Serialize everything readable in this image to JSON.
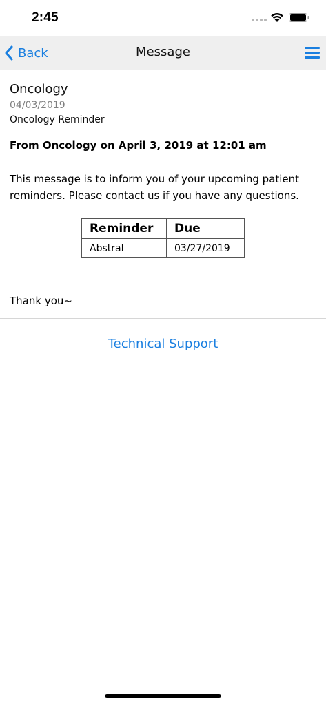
{
  "status_bar": {
    "time": "2:45"
  },
  "nav": {
    "back_label": "Back",
    "title": "Message"
  },
  "message": {
    "sender": "Oncology",
    "date": "04/03/2019",
    "subject": "Oncology Reminder",
    "from_line": "From Oncology on April 3, 2019 at 12:01 am",
    "body": "This message is to inform you of your upcoming patient reminders. Please contact us if you have any questions.",
    "closing": "Thank you~"
  },
  "reminder_table": {
    "headers": [
      "Reminder",
      "Due"
    ],
    "rows": [
      [
        "Abstral",
        "03/27/2019"
      ]
    ]
  },
  "footer": {
    "support_link": "Technical Support"
  },
  "colors": {
    "accent": "#1a7fe0",
    "nav_background": "#efefef"
  },
  "icons": {
    "back": "chevron-left-icon",
    "menu": "hamburger-menu-icon",
    "wifi": "wifi-icon",
    "battery": "battery-icon"
  }
}
